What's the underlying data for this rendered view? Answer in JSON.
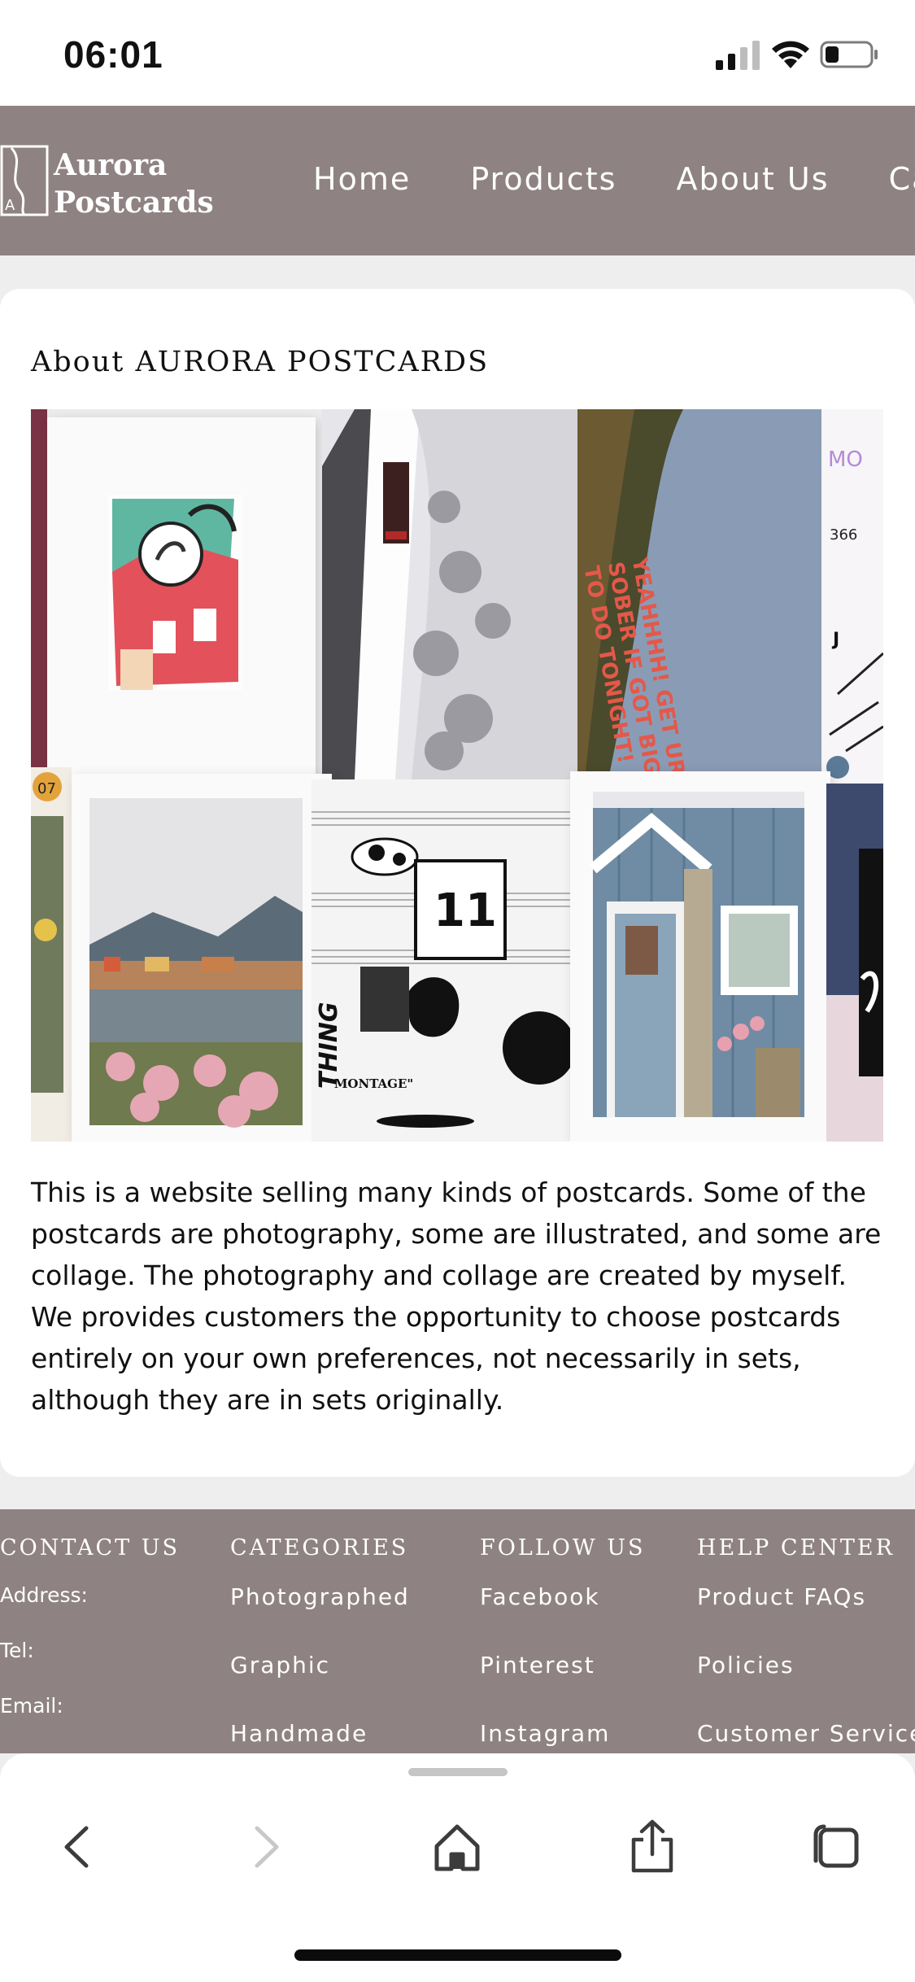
{
  "status_bar": {
    "time": "06:01",
    "icons": [
      "cellular-signal-icon",
      "wifi-icon",
      "battery-icon"
    ]
  },
  "header": {
    "logo_letter": "A",
    "logo_line1": "Aurora",
    "logo_line2": "Postcards",
    "nav": [
      "Home",
      "Products",
      "About Us",
      "Car"
    ]
  },
  "about": {
    "title": "About AURORA POSTCARDS",
    "body": "This is a website selling many kinds of postcards. Some of the postcards are photography, some are illustrated, and some are collage. The photography and collage are created by myself. We provides customers the opportunity to choose postcards entirely on your own preferences, not necessarily in sets, although they are in sets originally.",
    "collage_texts": {
      "red_headline": "YEAHHHH! GET UR ASS SOBER IF GOT BIG SHIT TO DO TONIGHT!",
      "calendar_number": "11",
      "thing": "THING",
      "montage": "\"MONTAGE\"",
      "badge": "07"
    }
  },
  "footer": {
    "contact": {
      "heading": "CONTACT US",
      "items": [
        "Address:",
        "Tel:",
        "Email:"
      ]
    },
    "categories": {
      "heading": "CATEGORIES",
      "items": [
        "Photographed",
        "Graphic",
        "Handmade"
      ]
    },
    "follow": {
      "heading": "FOLLOW US",
      "items": [
        "Facebook",
        "Pinterest",
        "Instagram"
      ]
    },
    "help": {
      "heading": "HELP CENTER",
      "items": [
        "Product FAQs",
        "Policies",
        "Customer Service"
      ]
    }
  },
  "browser_toolbar": {
    "icons": [
      "back-icon",
      "forward-icon",
      "home-icon",
      "share-icon",
      "tabs-icon"
    ]
  },
  "colors": {
    "header_bg": "#8f8282",
    "footer_bg": "#8f8282",
    "page_bg": "#efeeef"
  }
}
